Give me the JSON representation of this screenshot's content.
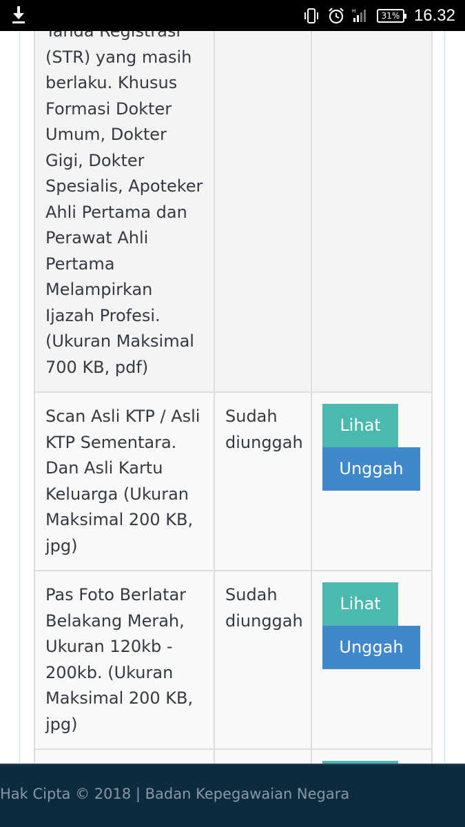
{
  "status_bar": {
    "download_icon": "download-icon",
    "vibrate_icon": "vibrate-icon",
    "alarm_icon": "alarm-icon",
    "signal_icon": "signal-icon",
    "battery": "31%",
    "time": "16.32"
  },
  "table": {
    "rows": [
      {
        "name": "Tanda Registrasi (STR) yang masih berlaku. Khusus Formasi Dokter Umum, Dokter Gigi, Dokter Spesialis, Apoteker Ahli Pertama dan Perawat Ahli Pertama Melampirkan Ijazah Profesi. (Ukuran Maksimal 700 KB, pdf)",
        "status": "",
        "view_label": "",
        "upload_label": ""
      },
      {
        "name": "Scan Asli KTP / Asli KTP Sementara. Dan Asli Kartu Keluarga (Ukuran Maksimal 200 KB, jpg)",
        "status": "Sudah diunggah",
        "view_label": "Lihat",
        "upload_label": "Unggah"
      },
      {
        "name": "Pas Foto Berlatar Belakang Merah, Ukuran 120kb - 200kb. (Ukuran Maksimal 200 KB, jpg)",
        "status": "Sudah diunggah",
        "view_label": "Lihat",
        "upload_label": "Unggah"
      }
    ]
  },
  "footer": {
    "copyright": "Hak Cipta © 2018 | Badan Kepegawaian Negara"
  },
  "colors": {
    "view_button": "#4bb9ae",
    "upload_button": "#3f88cc",
    "footer_bg": "#0d2b3e"
  }
}
